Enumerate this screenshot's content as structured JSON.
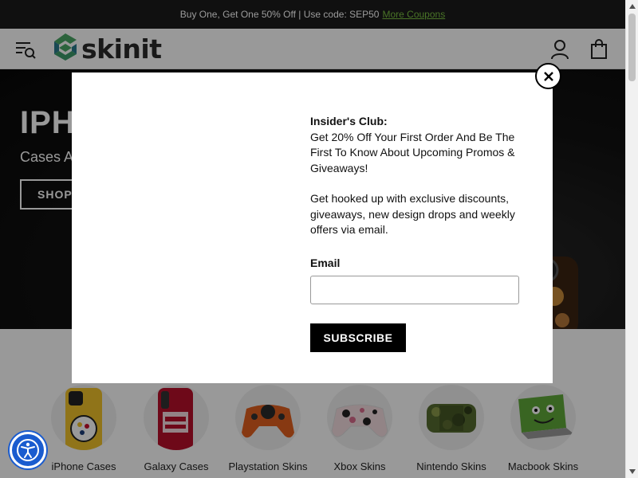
{
  "promo": {
    "text": "Buy One, Get One 50% Off | Use code: SEP50",
    "link": "More Coupons"
  },
  "header": {
    "logo_text": "skinit",
    "icons": [
      "menu-search-icon",
      "account-icon",
      "cart-icon"
    ]
  },
  "hero": {
    "title": "IPHO",
    "subtitle": "Cases A",
    "button": "SHOP I"
  },
  "categories": [
    {
      "label": "iPhone Cases",
      "icon": "iphone-case-image"
    },
    {
      "label": "Galaxy Cases",
      "icon": "galaxy-case-image"
    },
    {
      "label": "Playstation Skins",
      "icon": "playstation-controller-image"
    },
    {
      "label": "Xbox Skins",
      "icon": "xbox-controller-image"
    },
    {
      "label": "Nintendo Skins",
      "icon": "nintendo-switch-image"
    },
    {
      "label": "Macbook Skins",
      "icon": "macbook-image"
    }
  ],
  "modal": {
    "heading": "Insider's Club:",
    "offer": "Get 20% Off Your First Order And Be The First To Know About Upcoming Promos & Giveaways!",
    "description": "Get hooked up with exclusive discounts, giveaways, new design drops and weekly offers via email.",
    "email_label": "Email",
    "email_value": "",
    "email_placeholder": "",
    "subscribe_label": "SUBSCRIBE",
    "close_icon": "close-icon"
  },
  "colors": {
    "promo_bg": "#1b1b1b",
    "promo_link": "#7bc142",
    "logo_green": "#4aa564",
    "logo_teal": "#2a7a8c",
    "a11y_blue": "#1a5ccf"
  }
}
